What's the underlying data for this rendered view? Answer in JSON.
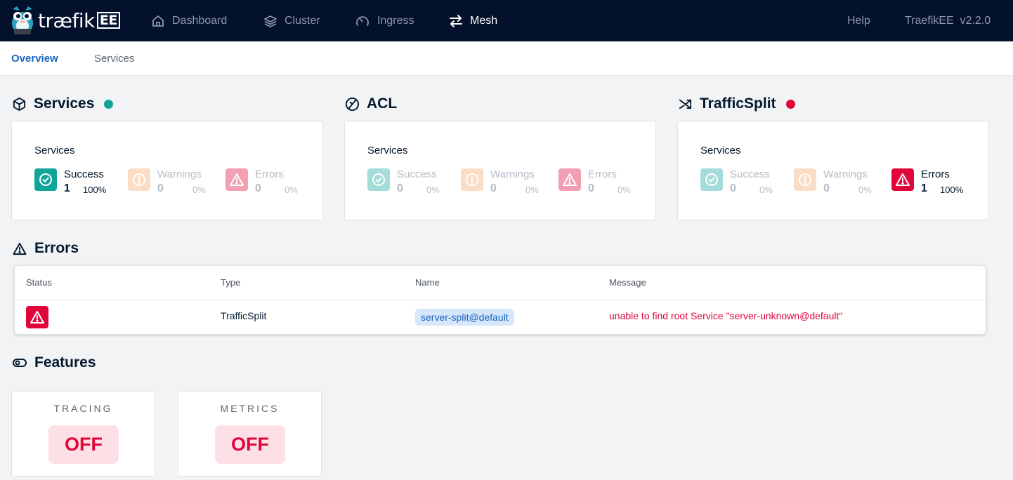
{
  "brand": {
    "logo_text": "træfik",
    "logo_badge": "EE",
    "version_label": "TraefikEE  v2.2.0"
  },
  "nav": {
    "dashboard": "Dashboard",
    "cluster": "Cluster",
    "ingress": "Ingress",
    "mesh": "Mesh",
    "help": "Help",
    "active": "Mesh"
  },
  "subtabs": {
    "overview": "Overview",
    "services": "Services",
    "active": "Overview"
  },
  "colors": {
    "success": "#11a59a",
    "warning": "#f5a86b",
    "error": "#e0063a",
    "accent": "#1867c0",
    "topbar": "#03112d"
  },
  "sections": {
    "services": {
      "title": "Services",
      "status_dot": "success",
      "card_label": "Services",
      "success": {
        "label": "Success",
        "count": "1",
        "pct": "100%"
      },
      "warnings": {
        "label": "Warnings",
        "count": "0",
        "pct": "0%"
      },
      "errors": {
        "label": "Errors",
        "count": "0",
        "pct": "0%"
      }
    },
    "acl": {
      "title": "ACL",
      "card_label": "Services",
      "success": {
        "label": "Success",
        "count": "0",
        "pct": "0%"
      },
      "warnings": {
        "label": "Warnings",
        "count": "0",
        "pct": "0%"
      },
      "errors": {
        "label": "Errors",
        "count": "0",
        "pct": "0%"
      }
    },
    "trafficsplit": {
      "title": "TrafficSplit",
      "status_dot": "error",
      "card_label": "Services",
      "success": {
        "label": "Success",
        "count": "0",
        "pct": "0%"
      },
      "warnings": {
        "label": "Warnings",
        "count": "0",
        "pct": "0%"
      },
      "errors": {
        "label": "Errors",
        "count": "1",
        "pct": "100%"
      }
    }
  },
  "errors": {
    "title": "Errors",
    "columns": {
      "status": "Status",
      "type": "Type",
      "name": "Name",
      "message": "Message"
    },
    "rows": [
      {
        "status": "error-icon",
        "type": "TrafficSplit",
        "name": "server-split@default",
        "message": "unable to find root Service \"server-unknown@default\""
      }
    ]
  },
  "features": {
    "title": "Features",
    "tracing": {
      "label": "TRACING",
      "value": "OFF"
    },
    "metrics": {
      "label": "METRICS",
      "value": "OFF"
    }
  }
}
